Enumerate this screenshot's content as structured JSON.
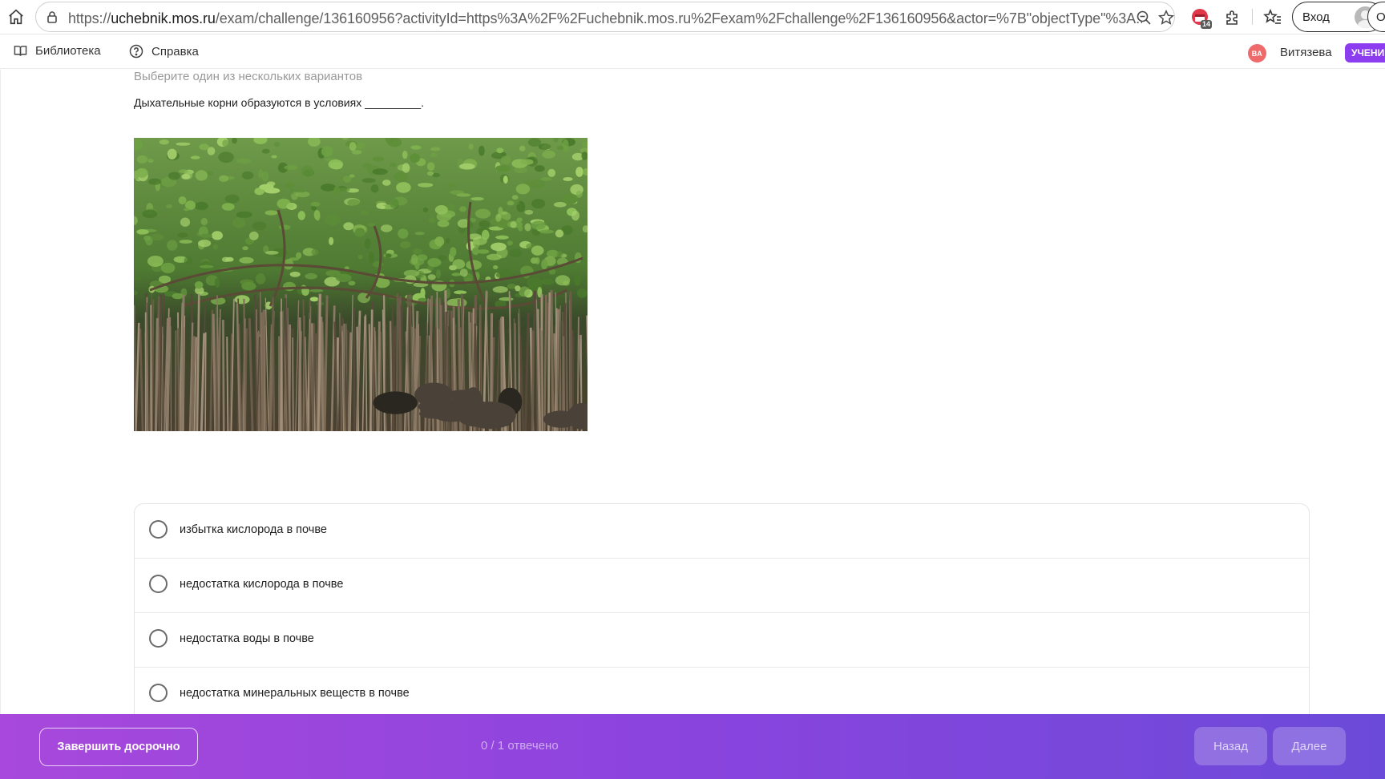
{
  "browser": {
    "url_prefix": "https://",
    "url_domain": "uchebnik.mos.ru",
    "url_rest": "/exam/challenge/136160956?activityId=https%3A%2F%2Fuchebnik.mos.ru%2Fexam%2Fchallenge%2F136160956&actor=%7B\"objectType\"%3A...",
    "extension_badge": "14",
    "login_label": "Вход",
    "cut_label": "Ot"
  },
  "header": {
    "library_label": "Библиотека",
    "help_label": "Справка",
    "user_initials": "ВА",
    "user_name": "Витязева",
    "role_badge": "УЧЕНИ"
  },
  "question": {
    "instruction": "Выберите один из нескольких вариантов",
    "text": "Дыхательные корни образуются в условиях _________.",
    "options": [
      "избытка кислорода в почве",
      "недостатка кислорода в почве",
      "недостатка воды в почве",
      "недостатка минеральных веществ в почве"
    ]
  },
  "footer": {
    "finish_label": "Завершить досрочно",
    "progress": "0 / 1 отвечено",
    "back_label": "Назад",
    "next_label": "Далее"
  },
  "colors": {
    "accent": "#8c3df0",
    "footer_start": "#a848dc",
    "footer_end": "#6c4ad9",
    "avatar": "#ef6b6b"
  }
}
